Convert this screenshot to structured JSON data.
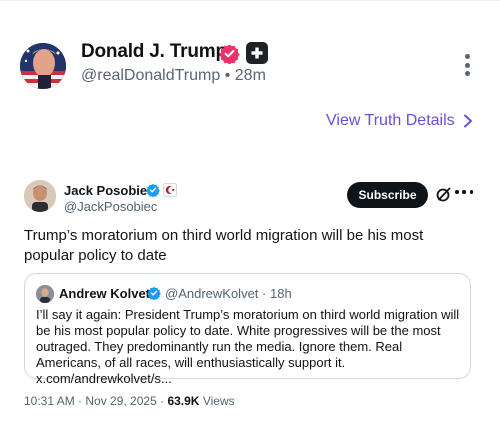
{
  "colors": {
    "link_purple": "#6a4fd6",
    "verified_pink": "#e8336c",
    "x_blue": "#1d9bf0",
    "text_primary": "#0f1419",
    "text_secondary": "#536471"
  },
  "truth_post": {
    "author_name": "Donald J. Trump",
    "handle": "@realDonaldTrump",
    "separator": "•",
    "time_ago": "28m",
    "view_details_label": "View Truth Details",
    "icons": [
      "avatar",
      "verified-badge-icon",
      "plus-badge-icon",
      "more-vertical-icon",
      "chevron-right-icon"
    ]
  },
  "embedded_post": {
    "author_name": "Jack Posobiec",
    "handle": "@JackPosobiec",
    "subscribe_label": "Subscribe",
    "text": "Trump’s moratorium on third world migration will be his most popular policy to date",
    "quote": {
      "author_name": "Andrew Kolvet",
      "handle": "@AndrewKolvet",
      "separator": "·",
      "time_ago": "18h",
      "text": "I’ll say it again: President Trump’s moratorium on third world migration will be his most popular policy to date. White progressives will be the most outraged. They predominantly run the media. Ignore them. Real Americans, of all races, will enthusiastically support it. x.com/andrewkolvet/s..."
    },
    "timestamp": "10:31 AM · Nov 29, 2025 ·",
    "views_count": "63.9K",
    "views_label": "Views",
    "icons": [
      "verified-icon",
      "flag-badge-icon",
      "grok-icon",
      "more-horizontal-icon"
    ]
  }
}
